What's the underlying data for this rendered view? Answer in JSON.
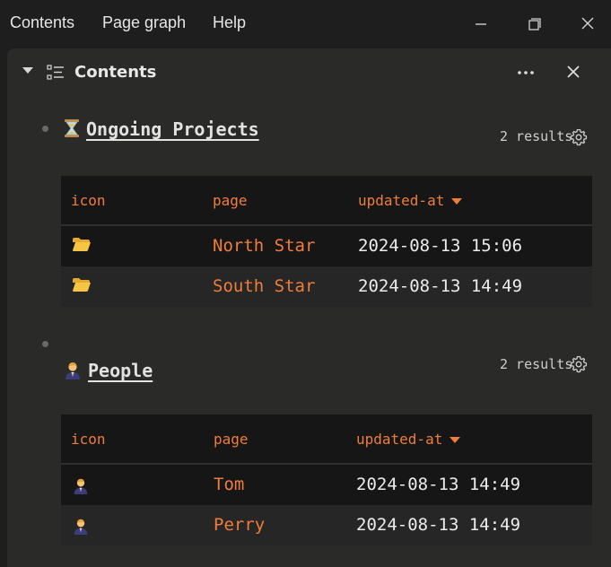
{
  "menu": {
    "contents": "Contents",
    "page_graph": "Page graph",
    "help": "Help"
  },
  "panel": {
    "title": "Contents"
  },
  "sections": [
    {
      "emoji": "hourglass",
      "title": "Ongoing Projects",
      "results": "2 results",
      "columns": [
        "icon",
        "page",
        "updated-at"
      ],
      "rows": [
        {
          "icon": "folder-icon",
          "page": "North Star",
          "updated_at": "2024-08-13 15:06"
        },
        {
          "icon": "folder-icon",
          "page": "South Star",
          "updated_at": "2024-08-13 14:49"
        }
      ]
    },
    {
      "emoji": "person",
      "title": "People",
      "results": "2 results",
      "columns": [
        "icon",
        "page",
        "updated-at"
      ],
      "rows": [
        {
          "icon": "person-icon",
          "page": "Tom",
          "updated_at": "2024-08-13 14:49"
        },
        {
          "icon": "person-icon",
          "page": "Perry",
          "updated_at": "2024-08-13 14:49"
        }
      ]
    }
  ],
  "colors": {
    "accent": "#f07d3c",
    "panel": "#2a2a28",
    "background": "#1e1e1e"
  }
}
